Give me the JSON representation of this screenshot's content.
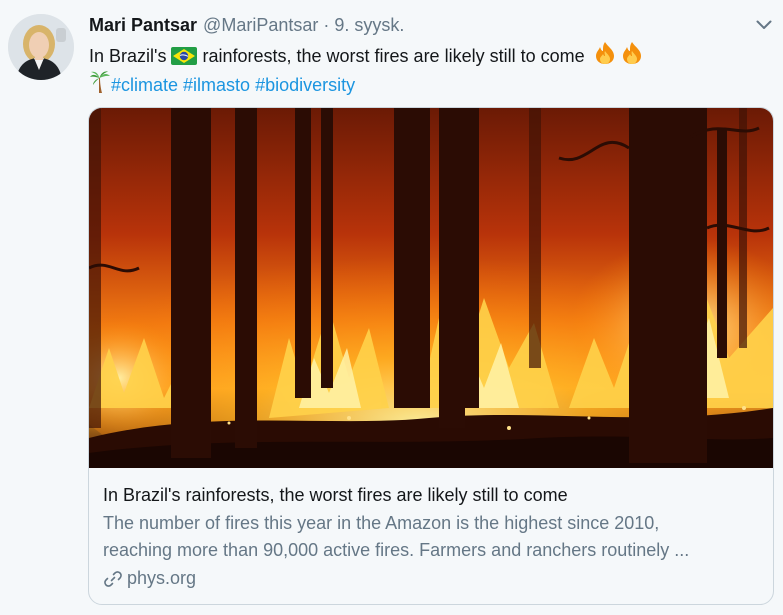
{
  "tweet": {
    "author_name": "Mari Pantsar",
    "author_handle": "@MariPantsar",
    "separator": "·",
    "date": "9. syysk.",
    "text_line1": "In Brazil's",
    "text_line1_rest": " rainforests, the worst fires are likely still to come",
    "hashtags": [
      "#climate",
      "#ilmasto",
      "#biodiversity"
    ],
    "icons": {
      "avatar": "avatar-photo",
      "flag": "brazil-flag-icon",
      "fire": "fire-icon",
      "palm": "palm-tree-icon",
      "menu": "chevron-down-icon",
      "link": "link-icon"
    }
  },
  "card": {
    "title": "In Brazil's rainforests, the worst fires are likely still to come",
    "description_line1": "The number of fires this year in the Amazon is the highest since 2010,",
    "description_line2": "reaching more than 90,000 active fires. Farmers and ranchers routinely ...",
    "domain": "phys.org"
  },
  "colors": {
    "background": "#f5f8fa",
    "text": "#14171a",
    "secondary": "#657786",
    "link": "#1b95e0",
    "border": "#ccd6dd"
  }
}
